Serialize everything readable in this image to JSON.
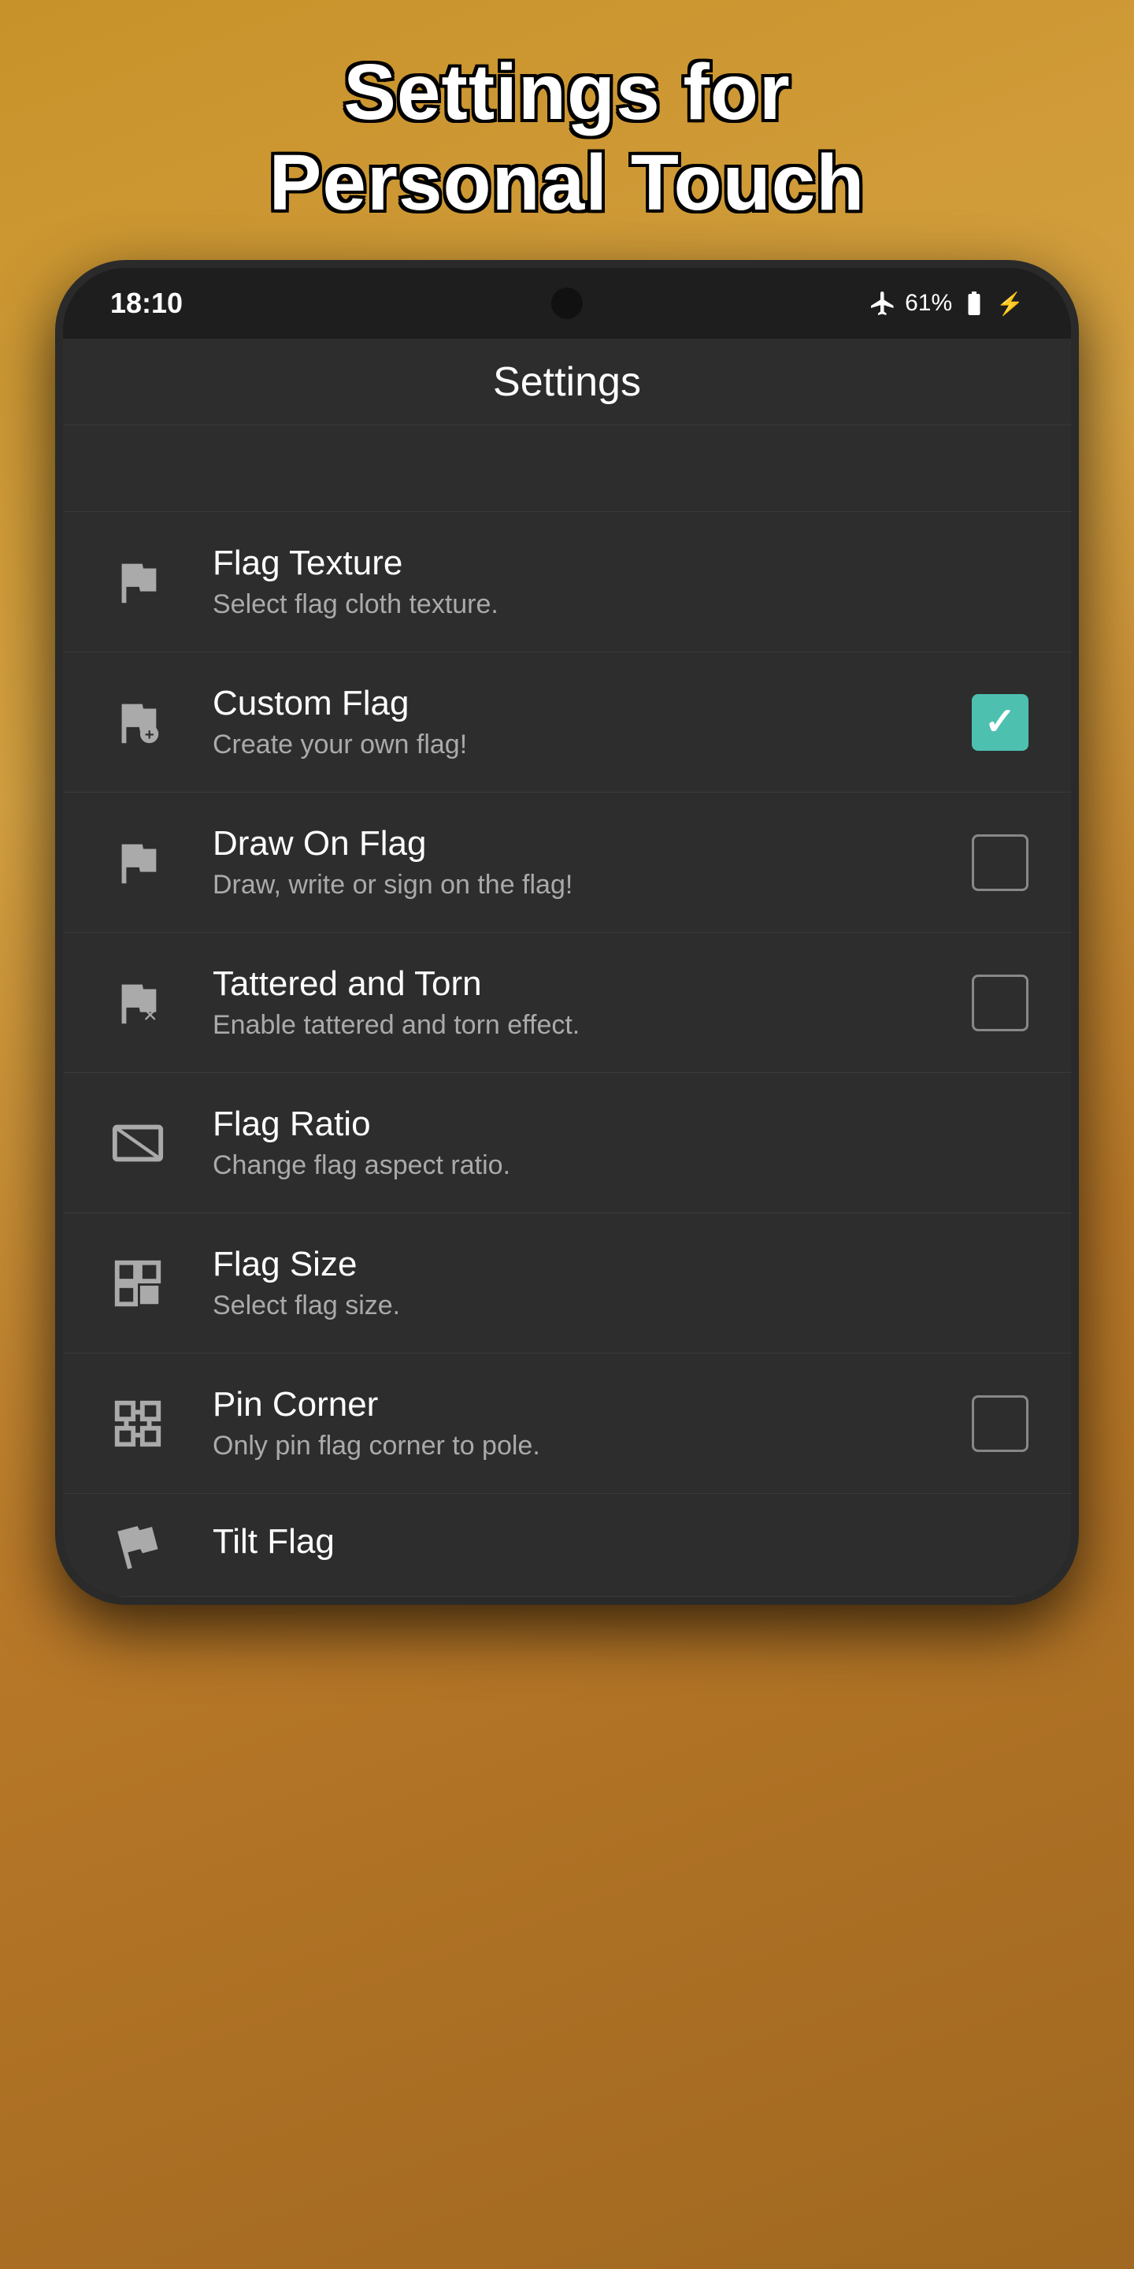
{
  "page": {
    "title_line1": "Settings for",
    "title_line2": "Personal Touch"
  },
  "status_bar": {
    "time": "18:10",
    "battery": "61%"
  },
  "app_bar": {
    "title": "Settings"
  },
  "settings_items": [
    {
      "id": "flag-texture",
      "title": "Flag Texture",
      "subtitle": "Select flag cloth texture.",
      "has_checkbox": false,
      "checked": false
    },
    {
      "id": "custom-flag",
      "title": "Custom Flag",
      "subtitle": "Create your own flag!",
      "has_checkbox": true,
      "checked": true
    },
    {
      "id": "draw-on-flag",
      "title": "Draw On Flag",
      "subtitle": "Draw, write or sign on the flag!",
      "has_checkbox": true,
      "checked": false
    },
    {
      "id": "tattered-and-torn",
      "title": "Tattered and Torn",
      "subtitle": "Enable tattered and torn effect.",
      "has_checkbox": true,
      "checked": false
    },
    {
      "id": "flag-ratio",
      "title": "Flag Ratio",
      "subtitle": "Change flag aspect ratio.",
      "has_checkbox": false,
      "checked": false
    },
    {
      "id": "flag-size",
      "title": "Flag Size",
      "subtitle": "Select flag size.",
      "has_checkbox": false,
      "checked": false
    },
    {
      "id": "pin-corner",
      "title": "Pin Corner",
      "subtitle": "Only pin flag corner to pole.",
      "has_checkbox": true,
      "checked": false
    },
    {
      "id": "tilt-flag",
      "title": "Tilt Flag",
      "subtitle": "",
      "has_checkbox": false,
      "checked": false
    }
  ]
}
